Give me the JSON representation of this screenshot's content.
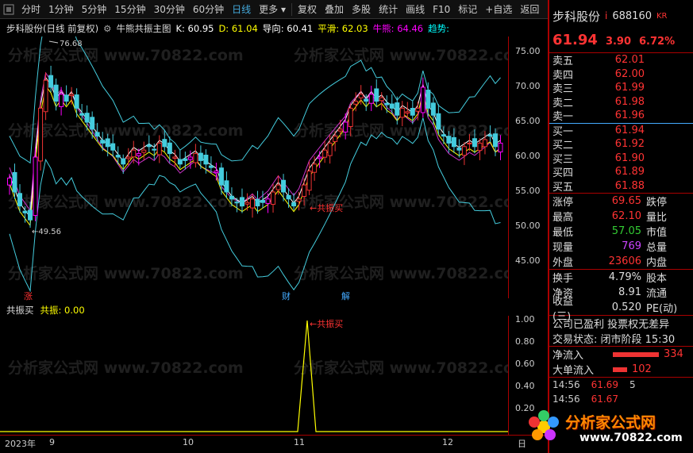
{
  "toolbar": {
    "items": [
      "分时",
      "1分钟",
      "5分钟",
      "15分钟",
      "30分钟",
      "60分钟",
      "日线",
      "更多",
      "复权",
      "叠加",
      "多股",
      "统计",
      "画线",
      "F10",
      "标记",
      "+自选",
      "返回"
    ],
    "active": "日线"
  },
  "title": {
    "stock": "步科股份(日线 前复权)",
    "indicator": "牛熊共振主图",
    "k": "K: 60.95",
    "d": "D: 61.04",
    "dao": "导向: 60.41",
    "ping": "平滑: 62.03",
    "niu": "牛熊: 64.46",
    "qs": "趋势:"
  },
  "main_axis": [
    "75.00",
    "70.00",
    "65.00",
    "60.00",
    "55.00",
    "50.00",
    "45.00"
  ],
  "annotations": {
    "high": "76.68",
    "low": "49.56",
    "buy": "共振买",
    "zhang": "涨",
    "cai": "财",
    "jie": "解"
  },
  "sub": {
    "name": "共振买",
    "value_label": "共振: 0.00",
    "axis": [
      "1.00",
      "0.80",
      "0.60",
      "0.40",
      "0.20"
    ],
    "mark": "共振买"
  },
  "dates": {
    "year": "2023年",
    "m9": "9",
    "m10": "10",
    "m11": "11",
    "m12": "12",
    "corner": "日"
  },
  "panel": {
    "name": "步科股份",
    "code": "688160",
    "badge": "KR",
    "price": "61.94",
    "change": "3.90",
    "pct": "6.72%",
    "asks": [
      {
        "label": "卖五",
        "value": "62.01"
      },
      {
        "label": "卖四",
        "value": "62.00"
      },
      {
        "label": "卖三",
        "value": "61.99"
      },
      {
        "label": "卖二",
        "value": "61.98"
      },
      {
        "label": "卖一",
        "value": "61.96"
      }
    ],
    "bids": [
      {
        "label": "买一",
        "value": "61.94"
      },
      {
        "label": "买二",
        "value": "61.92"
      },
      {
        "label": "买三",
        "value": "61.90"
      },
      {
        "label": "买四",
        "value": "61.89"
      },
      {
        "label": "买五",
        "value": "61.88"
      }
    ],
    "stats": [
      {
        "k": "涨停",
        "v": "69.65",
        "k2": "跌停",
        "color": "#f33"
      },
      {
        "k": "最高",
        "v": "62.10",
        "k2": "量比",
        "color": "#f33"
      },
      {
        "k": "最低",
        "v": "57.05",
        "k2": "市值",
        "color": "#3c3"
      },
      {
        "k": "现量",
        "v": "769",
        "k2": "总量",
        "color": "#c4f"
      },
      {
        "k": "外盘",
        "v": "23606",
        "k2": "内盘",
        "color": "#f33"
      }
    ],
    "stats2": [
      {
        "k": "换手",
        "v": "4.79%",
        "k2": "股本",
        "color": "#ddd"
      },
      {
        "k": "净资",
        "v": "8.91",
        "k2": "流通",
        "color": "#ddd"
      },
      {
        "k": "收益(三)",
        "v": "0.520",
        "k2": "PE(动)",
        "color": "#ddd"
      }
    ],
    "note1": "公司已盈利 投票权无差异",
    "note2": "交易状态: 闭市阶段 15:30",
    "flows": [
      {
        "k": "净流入",
        "v": "334"
      },
      {
        "k": "大单流入",
        "v": "102"
      }
    ],
    "ticks": [
      {
        "t": "14:56",
        "p": "61.69",
        "n": "5"
      },
      {
        "t": "14:56",
        "p": "61.67",
        "n": ""
      }
    ]
  },
  "watermark": "分析家公式网 www.70822.com",
  "logo": {
    "title": "分析家公式网",
    "url": "www.70822.com"
  }
}
